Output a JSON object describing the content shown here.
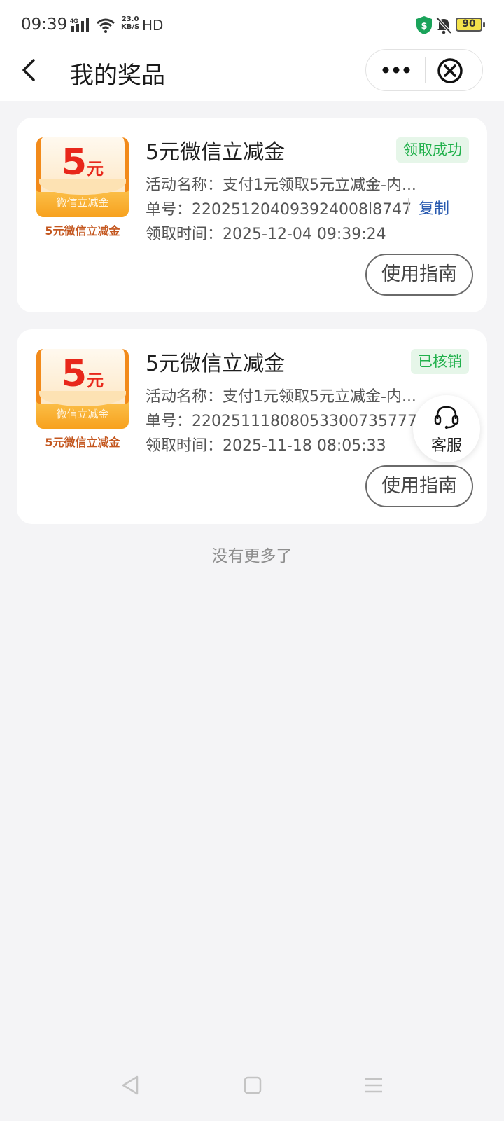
{
  "status_bar": {
    "time": "09:39",
    "network_type": "4G",
    "speed_value": "23.0",
    "speed_unit": "KB/S",
    "hd": "HD",
    "battery": "90"
  },
  "header": {
    "title": "我的奖品"
  },
  "labels": {
    "activity": "活动名称：",
    "order": "单号：",
    "time": "领取时间：",
    "copy": "复制",
    "guide": "使用指南"
  },
  "items": [
    {
      "coupon_amount": "5",
      "coupon_unit": "元",
      "coupon_sub": "微信立减金",
      "coupon_caption": "5元微信立减金",
      "title": "5元微信立减金",
      "status": "领取成功",
      "activity_name": "支付1元领取5元立减金-内...",
      "order_no": "220251204093924008l8747",
      "received_time": "2025-12-04 09:39:24"
    },
    {
      "coupon_amount": "5",
      "coupon_unit": "元",
      "coupon_sub": "微信立减金",
      "coupon_caption": "5元微信立减金",
      "title": "5元微信立减金",
      "status": "已核销",
      "activity_name": "支付1元领取5元立减金-内...",
      "order_no": "220251118080533007357773",
      "received_time": "2025-11-18 08:05:33"
    }
  ],
  "footer": {
    "no_more": "没有更多了"
  },
  "service": {
    "label": "客服"
  },
  "colors": {
    "success_green": "#20b04b",
    "coupon_red": "#e8271a",
    "coupon_orange": "#f7a11e",
    "link_blue": "#2a5bb0"
  }
}
